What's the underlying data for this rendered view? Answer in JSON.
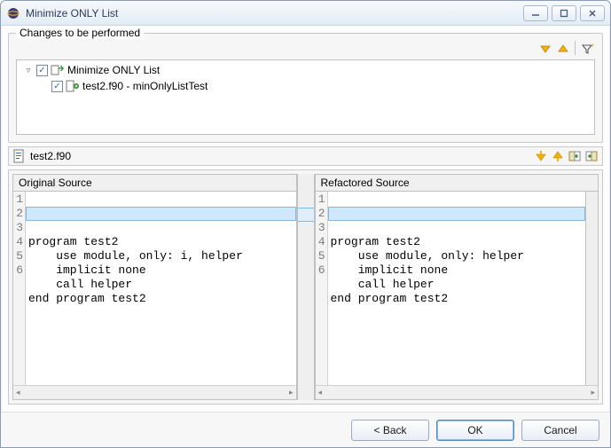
{
  "window": {
    "title": "Minimize ONLY List"
  },
  "changes": {
    "label": "Changes to be performed",
    "tree": [
      {
        "level": 0,
        "expander": "▽",
        "checked": true,
        "icon": "change-icon",
        "label": "Minimize ONLY List"
      },
      {
        "level": 1,
        "expander": "",
        "checked": true,
        "icon": "file-change-icon",
        "label": "test2.f90 - minOnlyListTest"
      }
    ]
  },
  "file": {
    "name": "test2.f90"
  },
  "compare": {
    "left_title": "Original Source",
    "right_title": "Refactored Source"
  },
  "chart_data": {
    "type": "table",
    "original_source": {
      "lines": [
        "program test2",
        "    use module, only: i, helper",
        "    implicit none",
        "    call helper",
        "end program test2",
        ""
      ],
      "highlighted_line": 2
    },
    "refactored_source": {
      "lines": [
        "program test2",
        "    use module, only: helper",
        "    implicit none",
        "    call helper",
        "end program test2",
        ""
      ],
      "highlighted_line": 2
    }
  },
  "buttons": {
    "back": "< Back",
    "ok": "OK",
    "cancel": "Cancel"
  }
}
